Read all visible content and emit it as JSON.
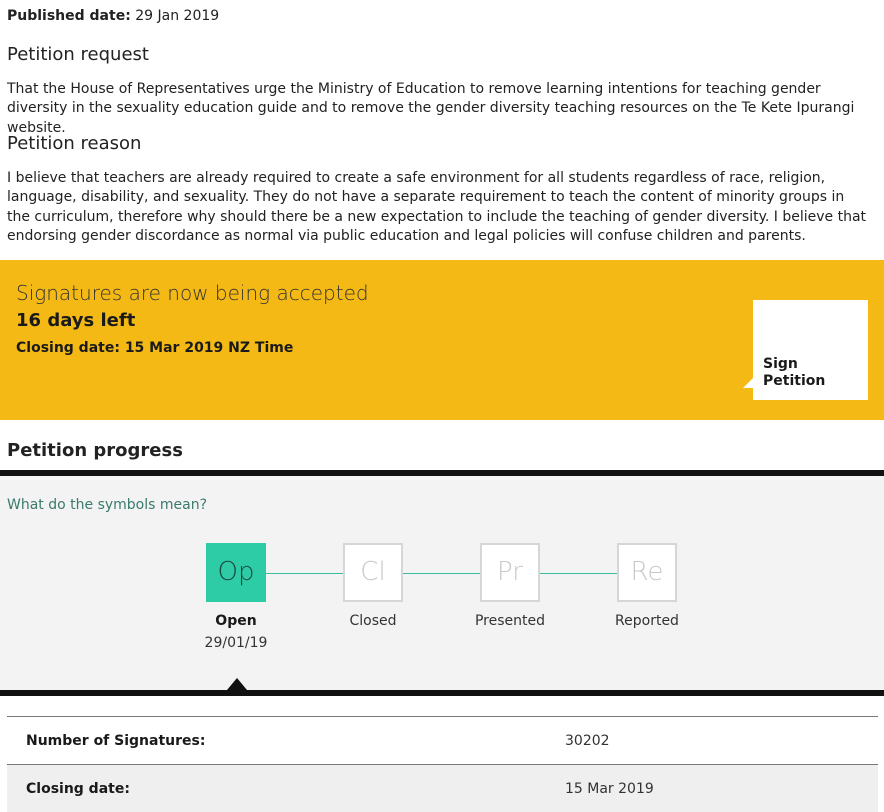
{
  "published": {
    "label": "Published date:",
    "value": "29 Jan 2019"
  },
  "request": {
    "heading": "Petition request",
    "text": "That the House of Representatives urge the Ministry of Education to remove learning intentions for teaching gender diversity in the sexuality education guide and to remove the gender diversity teaching resources on the Te Kete Ipurangi website."
  },
  "reason": {
    "heading": "Petition reason",
    "text": "I believe that teachers are already required to create a safe environment for all students regardless of race, religion, language, disability, and sexuality. They do not have a separate requirement to teach the content of minority groups in the curriculum, therefore why should there be a new expectation to include the teaching of gender diversity. I believe that endorsing gender discordance as normal via public education and legal policies will confuse children and parents."
  },
  "banner": {
    "status": "Signatures are now being accepted",
    "days_left": "16 days left",
    "closing": "Closing date: 15 Mar 2019 NZ Time",
    "sign_button": "Sign Petition",
    "color": "#f4b914"
  },
  "progress": {
    "heading": "Petition progress",
    "symbols_link": "What do the symbols mean?",
    "stages": [
      {
        "abbr": "Op",
        "label": "Open",
        "date": "29/01/19",
        "active": true
      },
      {
        "abbr": "Cl",
        "label": "Closed",
        "date": "",
        "active": false
      },
      {
        "abbr": "Pr",
        "label": "Presented",
        "date": "",
        "active": false
      },
      {
        "abbr": "Re",
        "label": "Reported",
        "date": "",
        "active": false
      }
    ],
    "active_color": "#2dcca7"
  },
  "details": [
    {
      "key": "Number of Signatures:",
      "value": "30202"
    },
    {
      "key": "Closing date:",
      "value": "15 Mar 2019"
    }
  ]
}
